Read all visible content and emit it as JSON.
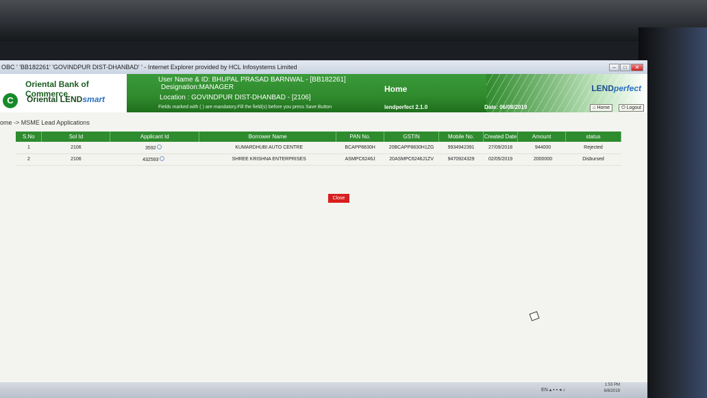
{
  "window": {
    "title": "OBC  ' 'BB182261' 'GOVINDPUR DIST-DHANBAD' ' - Internet Explorer provided by HCL Infosystems Limited"
  },
  "header": {
    "bank_name": "Oriental Bank of Commerce",
    "product_prefix": "Oriental LEND",
    "product_suffix": "smart",
    "user": "User Name & ID: BHUPAL PRASAD BARNWAL - [BB182261]",
    "designation": "Designation:MANAGER",
    "location": "Location : GOVINDPUR DIST-DHANBAD - [2106]",
    "mandatory_note": "Fields marked with (    ) are mandatory.Fill the field(s) before you press Save Button",
    "page_title": "Home",
    "app_version": "lendperfect 2.1.0",
    "date": "Date: 06/08/2019",
    "brand_prefix": "LEND",
    "brand_suffix": "perfect",
    "home_button": "Home",
    "logout_button": "Logout"
  },
  "breadcrumb": "ome -> MSME Lead Applications",
  "table": {
    "columns": [
      "S.No",
      "Sol Id",
      "Applicant Id",
      "Borrower Name",
      "PAN No.",
      "GSTIN",
      "Mobile No.",
      "Created Date",
      "Amount",
      "status"
    ],
    "rows": [
      {
        "sno": "1",
        "sol_id": "2106",
        "applicant_id": "3592",
        "borrower": "KUMARDHUBI AUTO CENTRE",
        "pan": "BCAPP8830H",
        "gstin": "20BCAPP8830H1ZG",
        "mobile": "9934942391",
        "created": "27/09/2018",
        "amount": "944000",
        "status": "Rejected"
      },
      {
        "sno": "2",
        "sol_id": "2106",
        "applicant_id": "432593",
        "borrower": "SHREE KRISHNA ENTERPRISES",
        "pan": "ASMPC6246J",
        "gstin": "20ASMPC6246J1ZV",
        "mobile": "9470924329",
        "created": "02/05/2019",
        "amount": "2000000",
        "status": "Disbursed"
      }
    ]
  },
  "close_button": "Close",
  "taskbar": {
    "lang": "EN",
    "time": "1:53 PM",
    "date": "6/8/2019"
  },
  "colors": {
    "header_green": "#2f8a2c",
    "table_header": "#2e8b2e",
    "close_red": "#d81e1e"
  }
}
